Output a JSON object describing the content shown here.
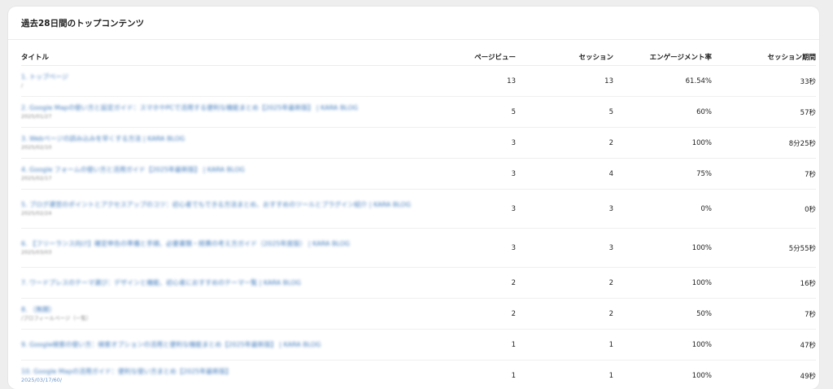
{
  "card": {
    "title": "過去28日間のトップコンテンツ"
  },
  "table": {
    "headers": [
      "タイトル",
      "ページビュー",
      "セッション",
      "エンゲージメント率",
      "セッション期間"
    ],
    "rows": [
      {
        "title": "1. トップページ",
        "sub": "/",
        "views": "13",
        "sessions": "13",
        "engagement": "61.54%",
        "duration": "33秒"
      },
      {
        "title": "2. Google Mapの使い方と設定ガイド：スマホやPCで活用する便利な機能まとめ【2025年最新版】 | KARA BLOG",
        "sub": "2025/01/27",
        "views": "5",
        "sessions": "5",
        "engagement": "60%",
        "duration": "57秒"
      },
      {
        "title": "3. Webページの読み込みを早くする方法 | KARA BLOG",
        "sub": "2025/02/10",
        "views": "3",
        "sessions": "2",
        "engagement": "100%",
        "duration": "8分25秒"
      },
      {
        "title": "4. Google フォームの使い方と活用ガイド【2025年最新版】 | KARA BLOG",
        "sub": "2025/02/17",
        "views": "3",
        "sessions": "4",
        "engagement": "75%",
        "duration": "7秒"
      },
      {
        "title": "5. ブログ運営のポイントとアクセスアップのコツ：初心者でもできる方法まとめ、おすすめのツールとプラグイン紹介 | KARA BLOG",
        "sub": "2025/02/24",
        "views": "3",
        "sessions": "3",
        "engagement": "0%",
        "duration": "0秒"
      },
      {
        "title": "6. 【フリーランス向け】確定申告の準備と手順、必要書類・経費の考え方ガイド（2025年度版） | KARA BLOG",
        "sub": "2025/03/03",
        "views": "3",
        "sessions": "3",
        "engagement": "100%",
        "duration": "5分55秒"
      },
      {
        "title": "7. ワードプレスのテーマ選び：デザインと機能、初心者におすすめのテーマ一覧 | KARA BLOG",
        "sub": "",
        "views": "2",
        "sessions": "2",
        "engagement": "100%",
        "duration": "16秒"
      },
      {
        "title": "8. （無題）",
        "sub": "/プロフィールページ（一覧）",
        "views": "2",
        "sessions": "2",
        "engagement": "50%",
        "duration": "7秒"
      },
      {
        "title": "9. Google検索の使い方：検索オプションの活用と便利な機能まとめ【2025年最新版】 | KARA BLOG",
        "sub": "",
        "views": "1",
        "sessions": "1",
        "engagement": "100%",
        "duration": "47秒"
      },
      {
        "title": "10. Google Mapの活用ガイド：便利な使い方まとめ【2025年最新版】",
        "sub": "2025/03/17/60/",
        "views": "1",
        "sessions": "1",
        "engagement": "100%",
        "duration": "49秒"
      }
    ]
  }
}
